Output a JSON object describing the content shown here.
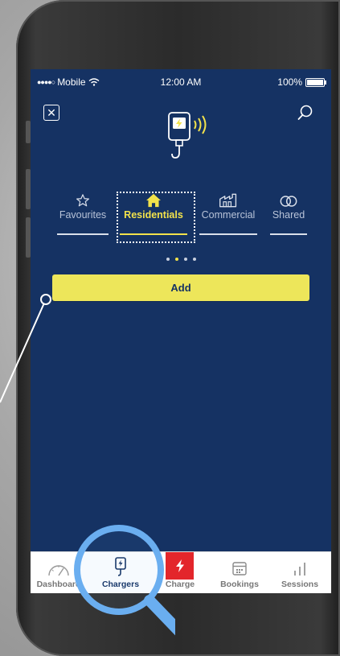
{
  "status": {
    "carrier": "Mobile",
    "time": "12:00 AM",
    "battery": "100%"
  },
  "header": {
    "close_symbol": "✕",
    "icons": [
      "close-icon",
      "search-icon",
      "charger-logo-icon"
    ]
  },
  "tabs": [
    {
      "label": "Favourites",
      "icon": "star-icon"
    },
    {
      "label": "Residentials",
      "icon": "home-icon",
      "active": true
    },
    {
      "label": "Commercial",
      "icon": "factory-icon"
    },
    {
      "label": "Shared",
      "icon": "rings-icon"
    }
  ],
  "pager": {
    "count": 4,
    "active_index": 1
  },
  "add_button": {
    "label": "Add"
  },
  "navbar": {
    "items": [
      {
        "label": "Dashboard",
        "icon": "speedometer-icon"
      },
      {
        "label": "Chargers",
        "icon": "charger-icon",
        "active": true
      },
      {
        "label": "Charge",
        "icon": "bolt-icon"
      },
      {
        "label": "Bookings",
        "icon": "calendar-icon"
      },
      {
        "label": "Sessions",
        "icon": "bar-chart-icon"
      }
    ]
  },
  "colors": {
    "screen_bg": "#153263",
    "accent_yellow": "#f2e24b",
    "add_button_bg": "#ede65a",
    "charge_red": "#e3262b",
    "magnifier_blue": "#6aaef0"
  }
}
